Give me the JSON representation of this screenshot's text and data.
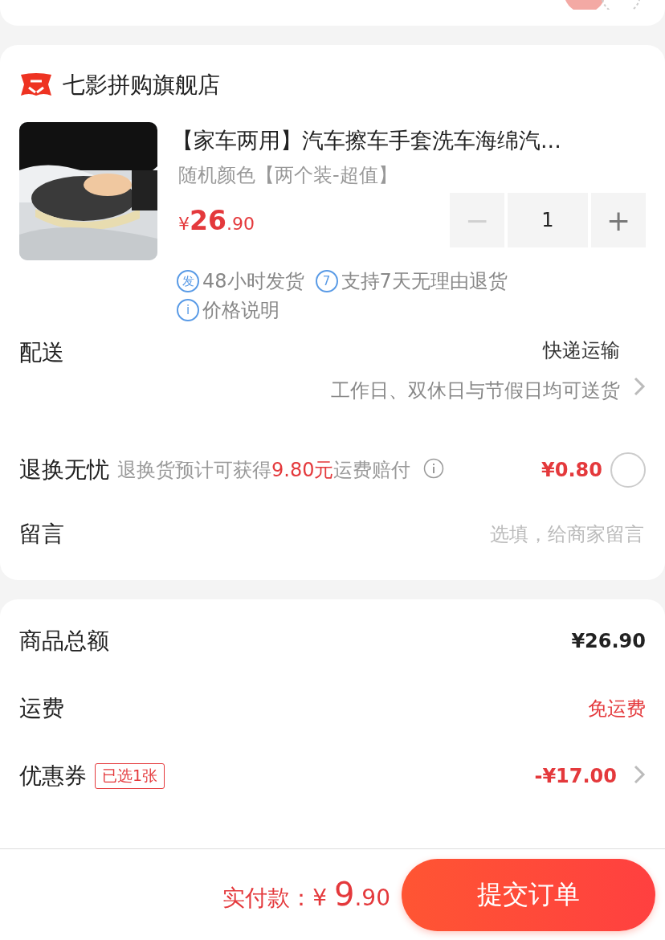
{
  "store": {
    "name": "七影拼购旗舰店"
  },
  "product": {
    "title": "【家车两用】汽车擦车手套洗车海绵汽...",
    "variant": "随机颜色【两个装-超值】",
    "price": {
      "symbol": "¥",
      "main": "26",
      "fraction": ".90"
    },
    "quantity": {
      "minus": "−",
      "value": "1",
      "plus": "+",
      "minus_disabled": true
    },
    "tags": [
      {
        "icon": "发",
        "text": "48小时发货"
      },
      {
        "icon": "7",
        "text": "支持7天无理由退货"
      },
      {
        "icon": "i",
        "text": "价格说明"
      }
    ]
  },
  "delivery": {
    "label": "配送",
    "method": "快递运输",
    "note": "工作日、双休日与节假日均可送货"
  },
  "return_insurance": {
    "label": "退换无忧",
    "note": [
      {
        "text": "退换货预计可获得",
        "highlight": false
      },
      {
        "text": "9.80元",
        "highlight": true
      },
      {
        "text": "运费赔付",
        "highlight": false
      }
    ],
    "price": "¥0.80",
    "checked": false
  },
  "message": {
    "label": "留言",
    "placeholder": "选填，给商家留言"
  },
  "summary": [
    {
      "label": "商品总额",
      "value": "¥26.90",
      "kind": "plain"
    },
    {
      "label": "运费",
      "value": "免运费",
      "kind": "red"
    },
    {
      "label": "优惠券",
      "badge": "已选1张",
      "value": "-¥17.00",
      "kind": "link"
    }
  ],
  "footer": {
    "label": "实付款：",
    "symbol": "¥",
    "main": "9",
    "fraction": ".90",
    "submit": "提交订单"
  }
}
